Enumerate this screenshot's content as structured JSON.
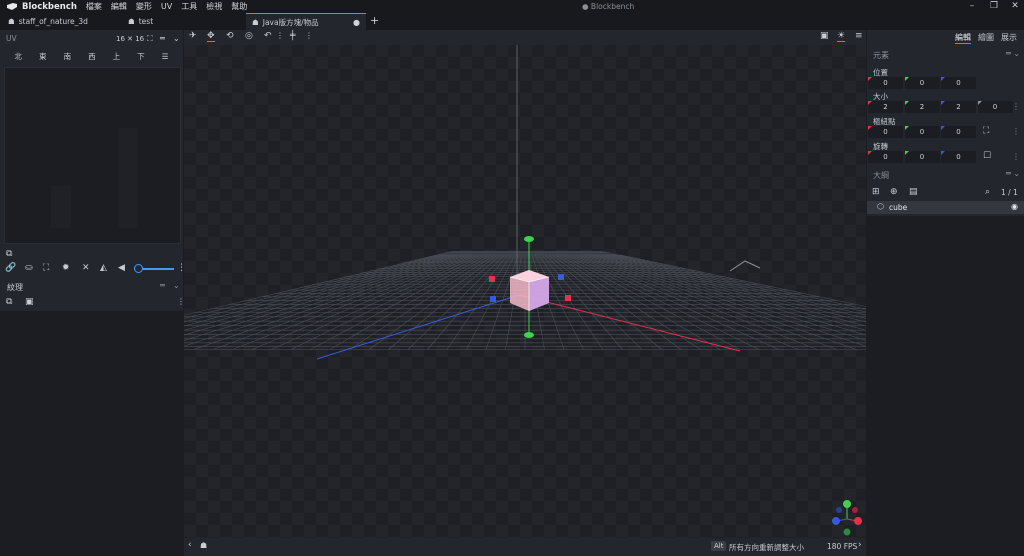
{
  "app": {
    "name": "Blockbench",
    "window_title": "● Blockbench",
    "menu": [
      "檔案",
      "編輯",
      "變形",
      "UV",
      "工具",
      "檢視",
      "幫助"
    ]
  },
  "tabs": [
    {
      "label": "staff_of_nature_3d",
      "active": false
    },
    {
      "label": "test",
      "active": false
    },
    {
      "label": "Java版方塊/物品",
      "active": true,
      "modified_marker": "●"
    }
  ],
  "new_tab": "+",
  "uv_panel": {
    "title": "UV",
    "size_label": "16 ✕ 16",
    "faces": [
      "北",
      "東",
      "南",
      "西",
      "上",
      "下"
    ]
  },
  "texture_panel": {
    "title": "紋理"
  },
  "mode_tabs": [
    {
      "label": "編輯",
      "active": true
    },
    {
      "label": "繪圖",
      "active": false
    },
    {
      "label": "展示",
      "active": false
    }
  ],
  "element_panel": {
    "title": "元素",
    "position": {
      "label": "位置",
      "values": [
        "0",
        "0",
        "0"
      ]
    },
    "size": {
      "label": "大小",
      "values": [
        "2",
        "2",
        "2",
        "0"
      ]
    },
    "pivot": {
      "label": "樞紐點",
      "values": [
        "0",
        "0",
        "0"
      ]
    },
    "rotation": {
      "label": "旋轉",
      "values": [
        "0",
        "0",
        "0"
      ]
    }
  },
  "outliner": {
    "title": "大綱",
    "count": "1 / 1",
    "items": [
      {
        "name": "cube"
      }
    ]
  },
  "status": {
    "key": "Alt",
    "hint": "所有方向重新調整大小",
    "fps": "180 FPS"
  },
  "colors": {
    "accent": "#3c9cff",
    "axis_x": "#e8304a",
    "axis_y": "#3fd14f",
    "axis_z": "#3a5bd9"
  },
  "icons": [
    "blockbench-logo",
    "minimize-icon",
    "maximize-icon",
    "close-icon",
    "move-icon",
    "rotate-icon",
    "pivot-icon",
    "eye-icon",
    "search-icon"
  ]
}
